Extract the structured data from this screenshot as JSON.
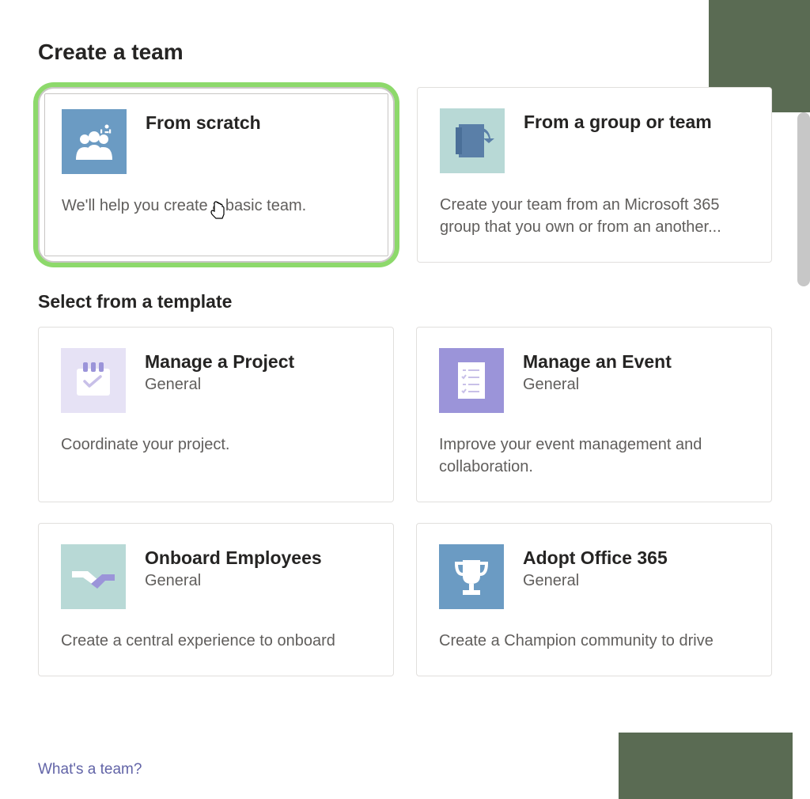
{
  "page_title": "Create a team",
  "section_title": "Select from a template",
  "top_cards": [
    {
      "title": "From scratch",
      "description": "We'll help you create a basic team.",
      "highlighted": true
    },
    {
      "title": "From a group or team",
      "description": "Create your team from an Microsoft 365 group that you own or from an another..."
    }
  ],
  "templates": [
    {
      "title": "Manage a Project",
      "subtitle": "General",
      "description": "Coordinate your project."
    },
    {
      "title": "Manage an Event",
      "subtitle": "General",
      "description": "Improve your event management and collaboration."
    },
    {
      "title": "Onboard Employees",
      "subtitle": "General",
      "description": "Create a central experience to onboard"
    },
    {
      "title": "Adopt Office 365",
      "subtitle": "General",
      "description": "Create a Champion community to drive"
    }
  ],
  "footer_link": "What's a team?"
}
